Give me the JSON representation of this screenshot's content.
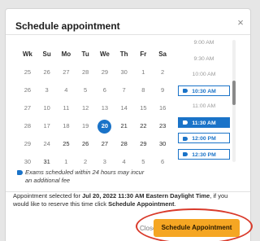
{
  "modal": {
    "title": "Schedule appointment",
    "close_icon": "×"
  },
  "calendar": {
    "weekdays": [
      "Wk",
      "Su",
      "Mo",
      "Tu",
      "We",
      "Th",
      "Fr",
      "Sa"
    ],
    "rows": [
      {
        "week": "25",
        "days": [
          "26",
          "27",
          "28",
          "29",
          "30",
          "1",
          "2"
        ]
      },
      {
        "week": "26",
        "days": [
          "3",
          "4",
          "5",
          "6",
          "7",
          "8",
          "9"
        ]
      },
      {
        "week": "27",
        "days": [
          "10",
          "11",
          "12",
          "13",
          "14",
          "15",
          "16"
        ]
      },
      {
        "week": "28",
        "days": [
          "17",
          "18",
          "19",
          "20",
          "21",
          "22",
          "23"
        ]
      },
      {
        "week": "29",
        "days": [
          "24",
          "25",
          "26",
          "27",
          "28",
          "29",
          "30"
        ]
      },
      {
        "week": "30",
        "days": [
          "31",
          "1",
          "2",
          "3",
          "4",
          "5",
          "6"
        ]
      }
    ],
    "selected_day": "20"
  },
  "note": "Exams scheduled within 24 hours may incur an additional fee",
  "times": [
    {
      "label": "9:00 AM",
      "state": "unavailable"
    },
    {
      "label": "9:30 AM",
      "state": "unavailable"
    },
    {
      "label": "10:00 AM",
      "state": "unavailable"
    },
    {
      "label": "10:30 AM",
      "state": "available"
    },
    {
      "label": "11:00 AM",
      "state": "unavailable"
    },
    {
      "label": "11:30 AM",
      "state": "selected"
    },
    {
      "label": "12:00 PM",
      "state": "available"
    },
    {
      "label": "12:30 PM",
      "state": "available"
    }
  ],
  "info": {
    "prefix": "Appointment selected for ",
    "datetime": "Jul 20, 2022 11:30 AM Eastern Daylight Time",
    "middle": ", if you would like to reserve this time click ",
    "action": "Schedule Appointment",
    "suffix": "."
  },
  "buttons": {
    "close": "Close",
    "schedule": "Schedule Appointment"
  },
  "colors": {
    "accent": "#1a73c8",
    "cta": "#f5a623",
    "annotation": "#d93a2b"
  }
}
